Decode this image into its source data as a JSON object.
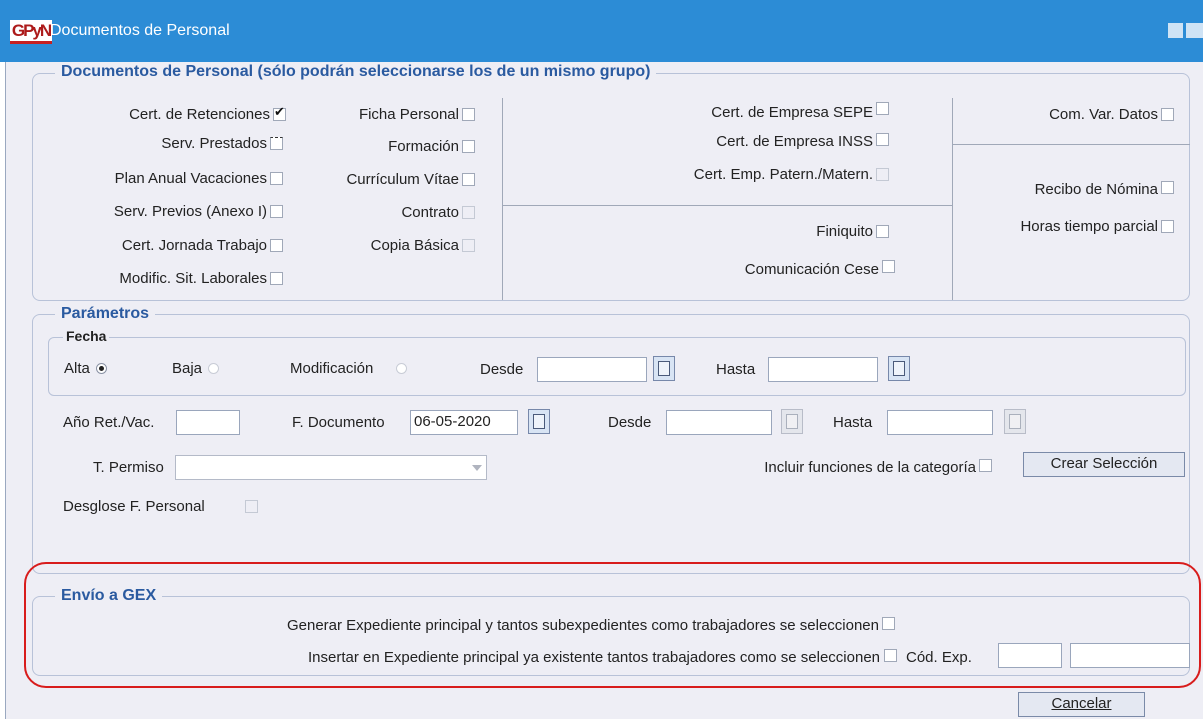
{
  "window": {
    "logo_text": "GPyN",
    "title": "Documentos de Personal"
  },
  "documents": {
    "legend": "Documentos de Personal (sólo podrán seleccionarse los de un mismo grupo)",
    "items": [
      {
        "label": "Cert. de Retenciones",
        "checked": true
      },
      {
        "label": "Serv. Prestados"
      },
      {
        "label": "Plan Anual Vacaciones"
      },
      {
        "label": "Serv. Previos (Anexo I)"
      },
      {
        "label": "Cert. Jornada Trabajo"
      },
      {
        "label": "Modific. Sit. Laborales"
      },
      {
        "label": "Ficha Personal"
      },
      {
        "label": "Formación"
      },
      {
        "label": "Currículum Vítae"
      },
      {
        "label": "Contrato"
      },
      {
        "label": "Copia Básica"
      },
      {
        "label": "Cert. de Empresa SEPE"
      },
      {
        "label": "Cert. de Empresa INSS"
      },
      {
        "label": "Cert. Emp. Patern./Matern."
      },
      {
        "label": "Finiquito"
      },
      {
        "label": "Comunicación Cese"
      },
      {
        "label": "Com. Var. Datos"
      },
      {
        "label": "Recibo de Nómina"
      },
      {
        "label": "Horas tiempo parcial"
      }
    ]
  },
  "params": {
    "legend": "Parámetros",
    "fecha_label": "Fecha",
    "alta": "Alta",
    "baja": "Baja",
    "modificacion": "Modificación",
    "selected_date_type": "Alta",
    "desde": "Desde",
    "hasta": "Hasta",
    "ano_ret_vac": "Año Ret./Vac.",
    "f_documento": "F. Documento",
    "f_documento_value": "06-05-2020",
    "desde2": "Desde",
    "hasta2": "Hasta",
    "t_permiso": "T. Permiso",
    "incluir": "Incluir funciones de la categoría",
    "crear_seleccion": "Crear Selección",
    "desglose": "Desglose F. Personal"
  },
  "gex": {
    "legend": "Envío a GEX",
    "generar": "Generar Expediente principal y tantos subexpedientes como trabajadores se seleccionen",
    "insertar": "Insertar en Expediente principal ya existente tantos trabajadores como se seleccionen",
    "cod_exp": "Cód. Exp."
  },
  "footer": {
    "cancelar": "Cancelar"
  },
  "colors": {
    "titlebar": "#2c8cd6",
    "panel": "#eeeef5",
    "legend": "#2a5aa0",
    "highlight": "#d81c1c"
  }
}
